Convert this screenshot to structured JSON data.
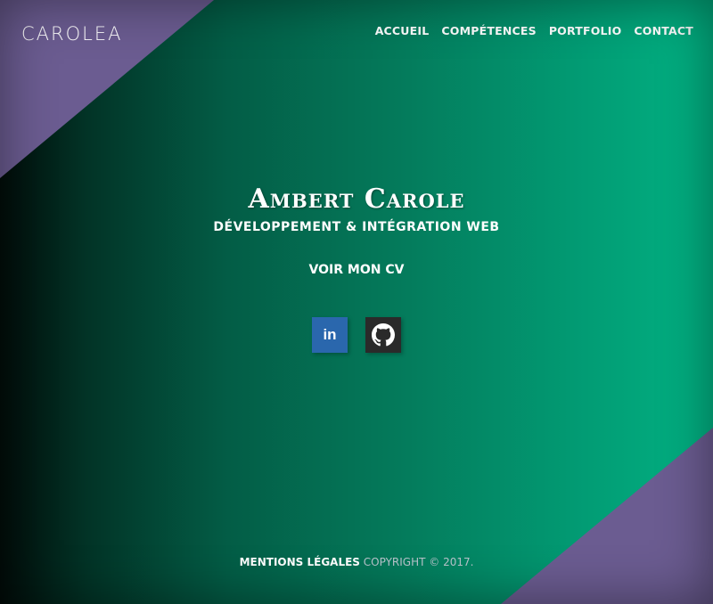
{
  "brand": {
    "logo": "CAROLEA",
    "accent": "#6b5c91"
  },
  "nav": {
    "items": [
      {
        "label": "ACCUEIL"
      },
      {
        "label": "COMPÉTENCES"
      },
      {
        "label": "PORTFOLIO"
      },
      {
        "label": "CONTACT"
      }
    ]
  },
  "hero": {
    "name": "Ambert Carole",
    "role": "Développement & intégration web",
    "cv_label": "Voir mon CV"
  },
  "socials": [
    {
      "icon": "linkedin-icon",
      "label": "in",
      "color": "#2a67ad"
    },
    {
      "icon": "github-icon",
      "color": "#2a2a2a"
    }
  ],
  "footer": {
    "legal_label": "Mentions légales",
    "copyright": "Copyright © 2017."
  }
}
